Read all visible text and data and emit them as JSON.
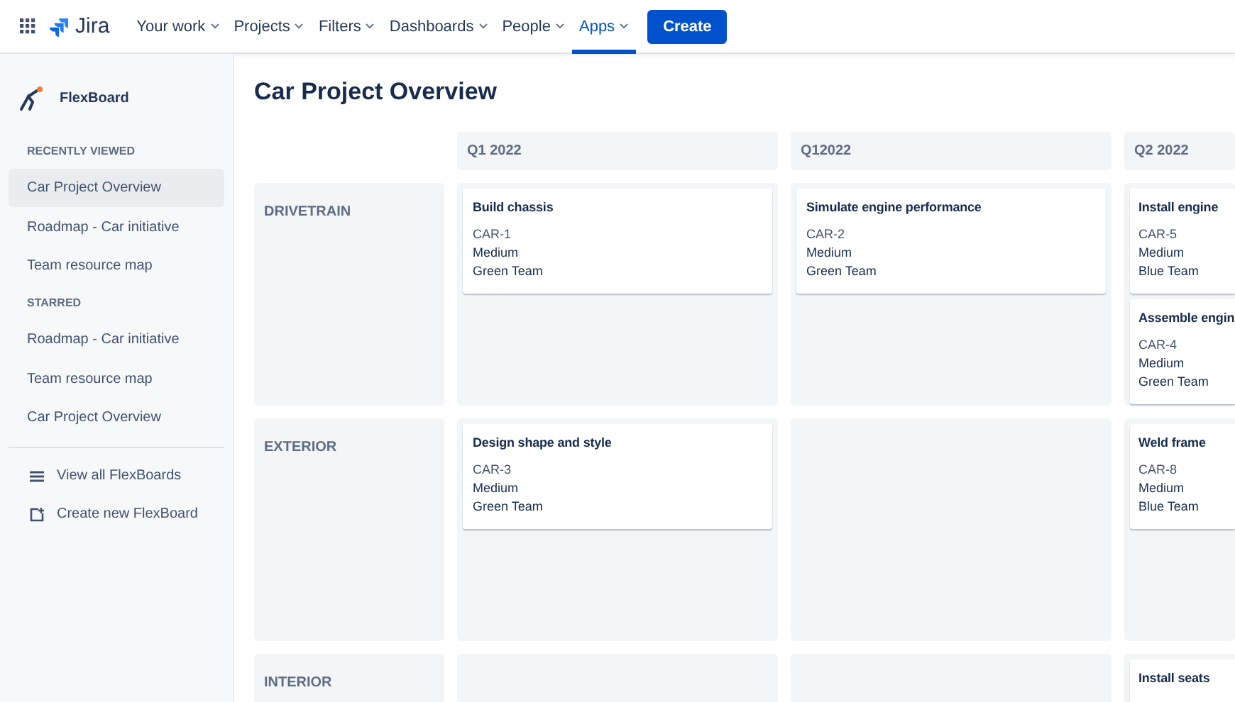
{
  "topbar": {
    "product": "Jira",
    "menu": [
      {
        "label": "Your work",
        "selected": false
      },
      {
        "label": "Projects",
        "selected": false
      },
      {
        "label": "Filters",
        "selected": false
      },
      {
        "label": "Dashboards",
        "selected": false
      },
      {
        "label": "People",
        "selected": false
      },
      {
        "label": "Apps",
        "selected": true
      }
    ],
    "create_button": "Create"
  },
  "sidebar": {
    "title": "FlexBoard",
    "sections": [
      {
        "heading": "RECENTLY VIEWED",
        "items": [
          {
            "label": "Car Project Overview",
            "selected": true
          },
          {
            "label": "Roadmap - Car initiative",
            "selected": false
          },
          {
            "label": "Team resource map",
            "selected": false
          }
        ]
      },
      {
        "heading": "STARRED",
        "items": [
          {
            "label": "Roadmap - Car initiative",
            "selected": false
          },
          {
            "label": "Team resource map",
            "selected": false
          },
          {
            "label": "Car Project Overview",
            "selected": false
          }
        ]
      }
    ],
    "actions": [
      {
        "label": "View all FlexBoards",
        "kind": "list"
      },
      {
        "label": "Create new FlexBoard",
        "kind": "new"
      }
    ]
  },
  "board": {
    "title": "Car Project Overview",
    "columns": [
      "Q1 2022",
      "Q12022",
      "Q2 2022"
    ],
    "rows": [
      {
        "label": "DRIVETRAIN",
        "cells": [
          [
            {
              "title": "Build chassis",
              "key": "CAR-1",
              "priority": "Medium",
              "team": "Green Team"
            }
          ],
          [
            {
              "title": "Simulate engine performance",
              "key": "CAR-2",
              "priority": "Medium",
              "team": "Green Team"
            }
          ],
          [
            {
              "title": "Install engine",
              "key": "CAR-5",
              "priority": "Medium",
              "team": "Blue Team"
            },
            {
              "title": "Assemble engin",
              "key": "CAR-4",
              "priority": "Medium",
              "team": "Green Team"
            }
          ]
        ]
      },
      {
        "label": "EXTERIOR",
        "cells": [
          [
            {
              "title": "Design shape and style",
              "key": "CAR-3",
              "priority": "Medium",
              "team": "Green Team"
            }
          ],
          [],
          [
            {
              "title": "Weld frame",
              "key": "CAR-8",
              "priority": "Medium",
              "team": "Blue Team"
            }
          ]
        ]
      },
      {
        "label": "INTERIOR",
        "cells": [
          [],
          [],
          [
            {
              "title": "Install seats"
            }
          ]
        ]
      }
    ]
  }
}
